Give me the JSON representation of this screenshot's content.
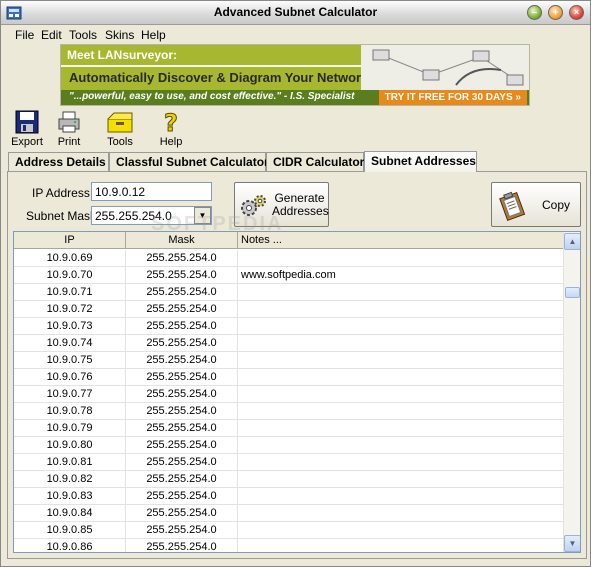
{
  "window": {
    "title": "Advanced Subnet Calculator"
  },
  "menu": [
    {
      "label": "File"
    },
    {
      "label": "Edit"
    },
    {
      "label": "Tools"
    },
    {
      "label": "Skins"
    },
    {
      "label": "Help"
    }
  ],
  "banner": {
    "headline": "Meet LANsurveyor:",
    "subhead": "Automatically Discover & Diagram Your Network",
    "quote": "\"...powerful, easy to use, and cost effective.\" - I.S. Specialist",
    "cta": "TRY IT FREE FOR 30 DAYS »"
  },
  "toolbar": {
    "export": "Export",
    "print": "Print",
    "tools": "Tools",
    "help": "Help"
  },
  "tabs": [
    {
      "label": "Address Details"
    },
    {
      "label": "Classful Subnet Calculator"
    },
    {
      "label": "CIDR Calculator"
    },
    {
      "label": "Subnet Addresses"
    }
  ],
  "form": {
    "ip_label": "IP Address",
    "ip_value": "10.9.0.12",
    "mask_label": "Subnet Mask",
    "mask_value": "255.255.254.0"
  },
  "buttons": {
    "generate_line1": "Generate",
    "generate_line2": "Addresses",
    "copy": "Copy"
  },
  "grid": {
    "headers": {
      "ip": "IP",
      "mask": "Mask",
      "notes": "Notes ..."
    },
    "rows": [
      {
        "ip": "10.9.0.69",
        "mask": "255.255.254.0",
        "notes": ""
      },
      {
        "ip": "10.9.0.70",
        "mask": "255.255.254.0",
        "notes": "www.softpedia.com"
      },
      {
        "ip": "10.9.0.71",
        "mask": "255.255.254.0",
        "notes": ""
      },
      {
        "ip": "10.9.0.72",
        "mask": "255.255.254.0",
        "notes": ""
      },
      {
        "ip": "10.9.0.73",
        "mask": "255.255.254.0",
        "notes": ""
      },
      {
        "ip": "10.9.0.74",
        "mask": "255.255.254.0",
        "notes": ""
      },
      {
        "ip": "10.9.0.75",
        "mask": "255.255.254.0",
        "notes": ""
      },
      {
        "ip": "10.9.0.76",
        "mask": "255.255.254.0",
        "notes": ""
      },
      {
        "ip": "10.9.0.77",
        "mask": "255.255.254.0",
        "notes": ""
      },
      {
        "ip": "10.9.0.78",
        "mask": "255.255.254.0",
        "notes": ""
      },
      {
        "ip": "10.9.0.79",
        "mask": "255.255.254.0",
        "notes": ""
      },
      {
        "ip": "10.9.0.80",
        "mask": "255.255.254.0",
        "notes": ""
      },
      {
        "ip": "10.9.0.81",
        "mask": "255.255.254.0",
        "notes": ""
      },
      {
        "ip": "10.9.0.82",
        "mask": "255.255.254.0",
        "notes": ""
      },
      {
        "ip": "10.9.0.83",
        "mask": "255.255.254.0",
        "notes": ""
      },
      {
        "ip": "10.9.0.84",
        "mask": "255.255.254.0",
        "notes": ""
      },
      {
        "ip": "10.9.0.85",
        "mask": "255.255.254.0",
        "notes": ""
      },
      {
        "ip": "10.9.0.86",
        "mask": "255.255.254.0",
        "notes": ""
      }
    ]
  },
  "watermark": "SOFTPEDIA",
  "colors": {
    "banner_green": "#a8b730",
    "banner_dark": "#5a7d1e",
    "cta_orange": "#e8891a"
  }
}
